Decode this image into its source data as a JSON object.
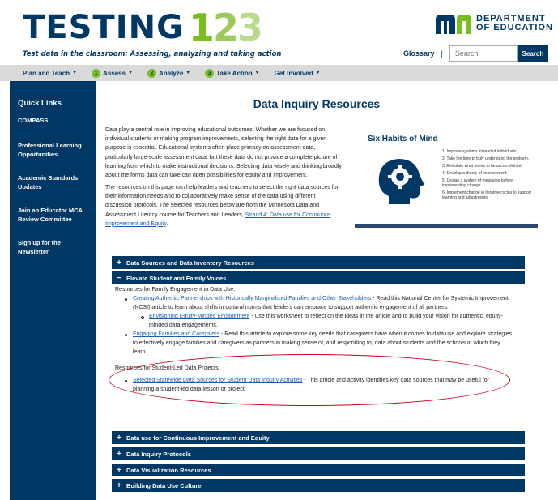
{
  "header": {
    "logo_word": "TESTING",
    "logo_digits": [
      "1",
      "2",
      "3"
    ],
    "tagline": "Test data in the classroom: Assessing, analyzing and taking action",
    "mde_line1": "DEPARTMENT",
    "mde_line2": "OF EDUCATION",
    "glossary": "Glossary",
    "separator": "|",
    "search_placeholder": "Search",
    "search_button": "Search"
  },
  "nav": [
    {
      "num": "",
      "label": "Plan and Teach"
    },
    {
      "num": "1",
      "label": "Assess"
    },
    {
      "num": "2",
      "label": "Analyze"
    },
    {
      "num": "3",
      "label": "Take Action"
    },
    {
      "num": "",
      "label": "Get Involved"
    }
  ],
  "sidebar": {
    "title": "Quick Links",
    "items": [
      "COMPASS",
      "Professional Learning Opportunities",
      "Academic Standards Updates",
      "Join an Educator MCA Review Committee",
      "Sign up for the Newsletter"
    ]
  },
  "main": {
    "title": "Data Inquiry Resources",
    "intro_p1": "Data play a central role in improving educational outcomes. Whether we are focused on individual students or making program improvements, selecting the right data for a given purpose is essential. Educational systems often place primacy on assessment data, particularly large-scale assessment data, but these data do not provide a complete picture of learning from which to make instructional decisions. Selecting data wisely and thinking broadly about the forms data can take can open possibilities for equity and improvement.",
    "intro_p2": "The resources on this page can help leaders and teachers to select the right data sources for their information needs and to collaboratively make sense of the data using different discussion protocols. The selected resources below are from the Minnesota Data and Assessment Literacy course for Teachers and Leaders,",
    "intro_link": "Strand 4: Data use for Continuous Improvement and Equity",
    "intro_end": "."
  },
  "habits": {
    "title": "Six Habits of Mind",
    "items": [
      "1. Improve systems instead of individuals.",
      "2. Take the time to truly understand the problem.",
      "3. Articulate what needs to be accomplished.",
      "4. Develop a theory of improvement.",
      "5. Design a system of measures before implementing change.",
      "6. Implement change in iterative cycles to support learning and adjustments."
    ]
  },
  "accordions": {
    "a1": "Data Sources and Data Inventory Resources",
    "a2": "Elevate Student and Family Voices",
    "a3": "Data use for Continuous Improvement and Equity",
    "a4": "Data Inquiry Protocols",
    "a5": "Data Visualization Resources",
    "a6": "Building Data Use Culture",
    "plus": "+",
    "minus": "−"
  },
  "panel": {
    "family_label": "Resources for Family Engagement in Data Use:",
    "link1": "Creating Authentic Partnerships with Historically Marginalized Families and Other Stakeholders",
    "text1a": " - Read this National Center for Systemic Improvement",
    "text1b": "(NCSI) article to learn about shifts in cultural norms that leaders can embrace to support authentic engagement of all partners.",
    "sublink": "Envisioning Equity-Minded Engagement",
    "subtext_a": " - Use this worksheet to reflect on the ideas in the article and to build your vision for authentic, equity-",
    "subtext_b": "minded data engagements.",
    "link2": "Engaging Families and Caregivers",
    "text2a": " - Read this article to explore some key needs that caregivers have when it comes to data use and explore strategies",
    "text2b": "to effectively engage families and caregivers as partners in making sense of, and responding to, data about students and the schools in which they",
    "text2c": "learn.",
    "student_label": "Resources for Student-Led Data Projects:",
    "link3": "Selected Statewide Data Sources for Student Data Inquiry Activities",
    "text3a": " - This article and activity identifies key data sources that may be useful for",
    "text3b": "planning a student-led data lesson or project."
  },
  "colors": {
    "navy": "#003865",
    "green": "#78be20",
    "link": "#1a5fb4",
    "annotation": "#d0021b"
  }
}
